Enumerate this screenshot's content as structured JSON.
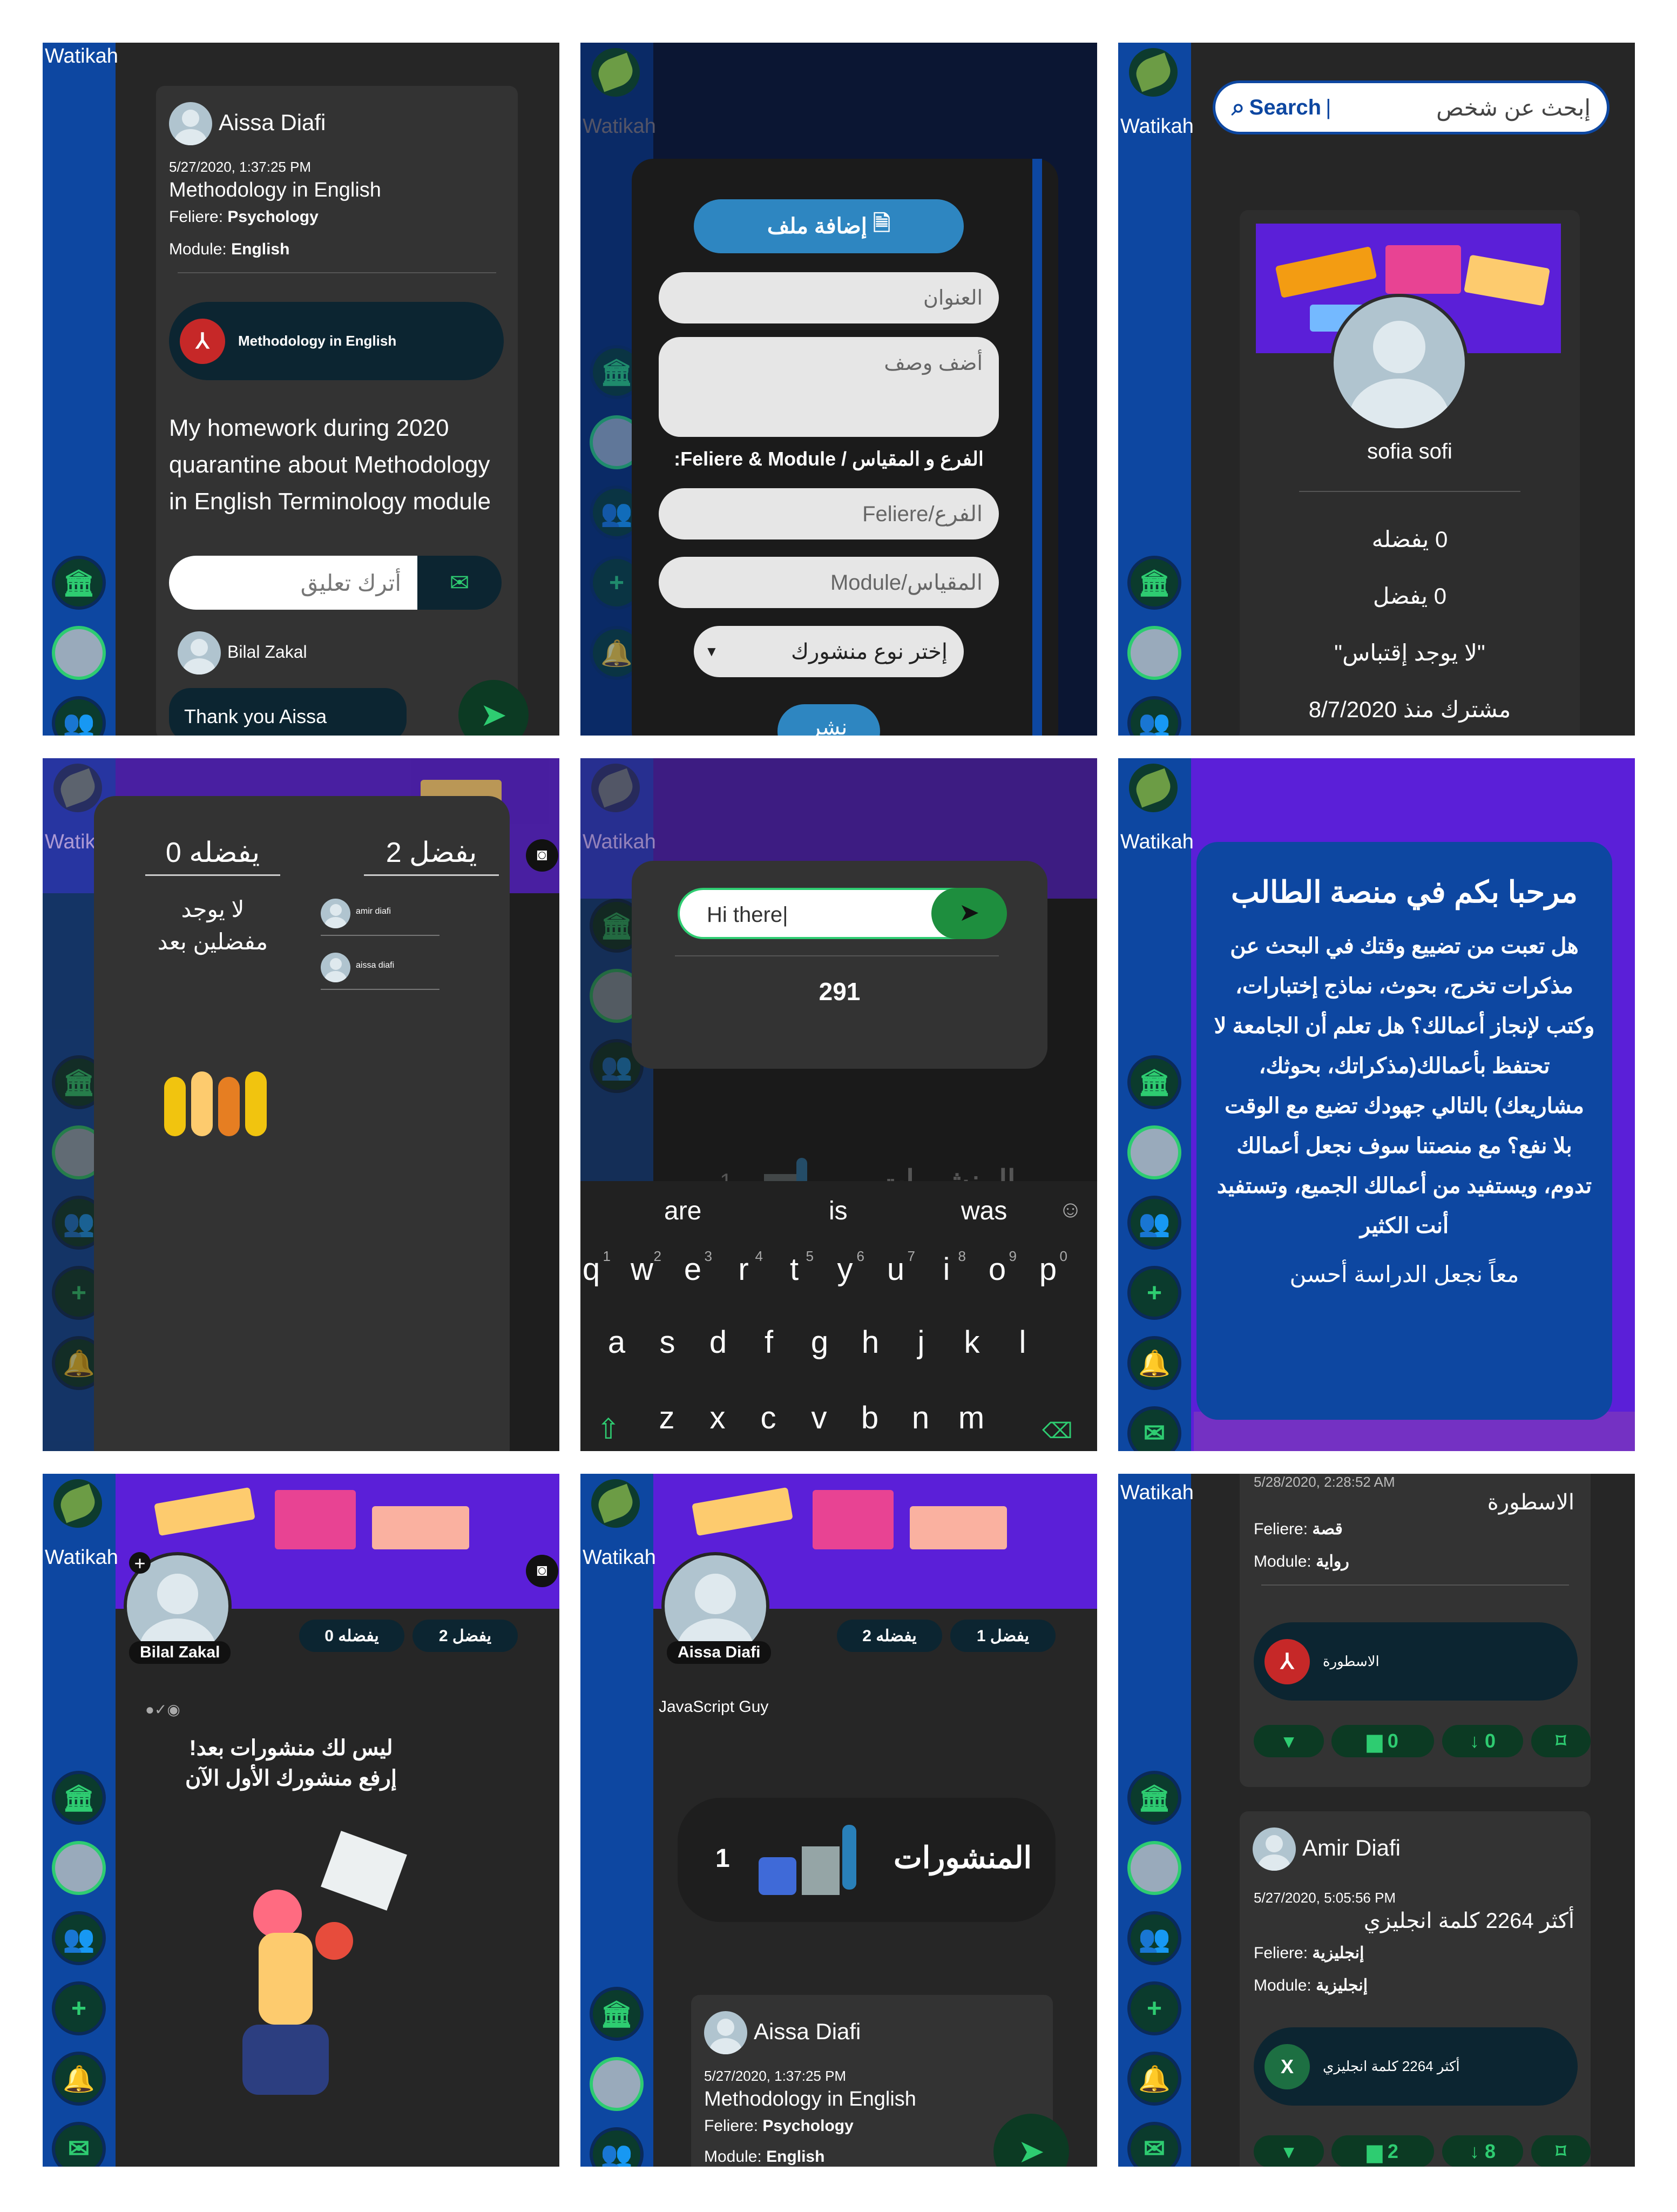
{
  "brand": "Watikah",
  "p1": {
    "author": "Aissa Diafi",
    "date": "5/27/2020, 1:37:25 PM",
    "title": "Methodology in English",
    "feliere_label": "Feliere:",
    "feliere": "Psychology",
    "module_label": "Module:",
    "module": "English",
    "file": "Methodology in English",
    "body": "My homework during 2020 quarantine about Methodology in English Terminology module",
    "comment_placeholder": "أترك تعليق",
    "commenter": "Bilal Zakal",
    "comment": "Thank you Aissa"
  },
  "p2": {
    "add_file": "إضافة ملف",
    "title_ph": "العنوان",
    "desc_ph": "أضف وصف",
    "section": "الفرع و المقياس / Feliere & Module:",
    "feliere_ph": "Feliere/الفرع",
    "module_ph": "Module/المقياس",
    "type": "إختر نوع منشورك",
    "publish": "نشر"
  },
  "p3": {
    "search_label": "Search",
    "search_ph": "إبحث عن شخص",
    "name": "sofia sofi",
    "fav1": "0 يفضله",
    "fav2": "0 يفضل",
    "quote": "لا يوجد إقتباس",
    "since": "مشترك منذ 8/7/2020"
  },
  "p4": {
    "col1": "يفضل 2",
    "col2": "يفضله 0",
    "none": "لا يوجد مفضلين بعد",
    "u1": "amir diafi",
    "u2": "aissa diafi"
  },
  "p5": {
    "input": "Hi there",
    "count": "291",
    "posts": "المنشورات",
    "posts_count": "1",
    "suggestions": [
      "are",
      "is",
      "was"
    ],
    "row1": [
      "q",
      "w",
      "e",
      "r",
      "t",
      "y",
      "u",
      "i",
      "o",
      "p"
    ],
    "row1n": [
      "1",
      "2",
      "3",
      "4",
      "5",
      "6",
      "7",
      "8",
      "9",
      "0"
    ],
    "row2": [
      "a",
      "s",
      "d",
      "f",
      "g",
      "h",
      "j",
      "k",
      "l"
    ],
    "row3": [
      "z",
      "x",
      "c",
      "v",
      "b",
      "n",
      "m"
    ]
  },
  "p6": {
    "title": "مرحبا بكم في منصة الطالب",
    "body": "هل تعبت من تضييع وقتك في البحث عن مذكرات تخرج، بحوث، نماذج إختبارات، وكتب لإنجاز أعمالك؟ هل تعلم أن الجامعة لا تحتفظ بأعمالك(مذكراتك، بحوثك، مشاريعك) بالتالي جهودك تضيع مع الوقت بلا نفع؟ مع منصتنا سوف نجعل أعمالك تدوم، ويستفيد من أعمالك الجميع، وتستفيد أنت الكثير",
    "footer": "معاً نجعل الدراسة أحسن"
  },
  "p7": {
    "name": "Bilal Zakal",
    "fav1": "يفضله 0",
    "fav2": "يفضل 2",
    "empty": "ليس لك منشورات بعد! إرفع منشورك الأول الآن"
  },
  "p8": {
    "name": "Aissa Diafi",
    "fav1": "يفضله 2",
    "fav2": "يفضل 1",
    "bio": "JavaScript Guy",
    "posts": "المنشورات",
    "posts_count": "1",
    "author": "Aissa Diafi",
    "date": "5/27/2020, 1:37:25 PM",
    "title": "Methodology in English",
    "feliere_label": "Feliere:",
    "feliere": "Psychology",
    "module_label": "Module:",
    "module": "English"
  },
  "p9": {
    "date1": "5/28/2020, 2:28:52 AM",
    "title1": "الاسطورة",
    "feliere1": "قصة",
    "module1": "رواية",
    "file1": "الاسطورة",
    "c1": "0",
    "d1": "0",
    "author2": "Amir Diafi",
    "date2": "5/27/2020, 5:05:56 PM",
    "title2": "أكثر 2264 كلمة انجليزي",
    "feliere2": "إنجليزية",
    "module2": "إنجليزية",
    "file2": "أكثر 2264 كلمة انجليزي",
    "c2": "2",
    "d2": "8",
    "feliere_label": "Feliere:",
    "module_label": "Module:"
  }
}
